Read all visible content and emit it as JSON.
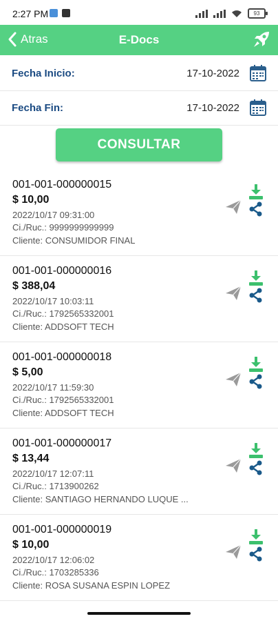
{
  "status_bar": {
    "time": "2:27 PM",
    "battery": "93"
  },
  "app_bar": {
    "back_label": "Atras",
    "title": "E-Docs",
    "action_icon": "rocket-icon"
  },
  "filters": {
    "start_label": "Fecha Inicio:",
    "start_value": "17-10-2022",
    "end_label": "Fecha Fin:",
    "end_value": "17-10-2022",
    "submit_label": "CONSULTAR"
  },
  "documents": [
    {
      "number": "001-001-000000015",
      "amount": "$ 10,00",
      "datetime": "2022/10/17 09:31:00",
      "ruc": "Ci./Ruc.: 9999999999999",
      "client": "Cliente: CONSUMIDOR FINAL"
    },
    {
      "number": "001-001-000000016",
      "amount": "$ 388,04",
      "datetime": "2022/10/17 10:03:11",
      "ruc": "Ci./Ruc.: 1792565332001",
      "client": "Cliente: ADDSOFT TECH"
    },
    {
      "number": "001-001-000000018",
      "amount": "$ 5,00",
      "datetime": "2022/10/17 11:59:30",
      "ruc": "Ci./Ruc.: 1792565332001",
      "client": "Cliente: ADDSOFT TECH"
    },
    {
      "number": "001-001-000000017",
      "amount": "$ 13,44",
      "datetime": "2022/10/17 12:07:11",
      "ruc": "Ci./Ruc.: 1713900262",
      "client": "Cliente: SANTIAGO HERNANDO LUQUE ..."
    },
    {
      "number": "001-001-000000019",
      "amount": "$ 10,00",
      "datetime": "2022/10/17 12:06:02",
      "ruc": "Ci./Ruc.: 1703285336",
      "client": "Cliente: ROSA SUSANA ESPIN LOPEZ"
    }
  ],
  "colors": {
    "primary_green": "#55d183",
    "label_blue": "#1a4a82",
    "share_blue": "#1a5a8a",
    "send_gray": "#9a9a9a"
  }
}
